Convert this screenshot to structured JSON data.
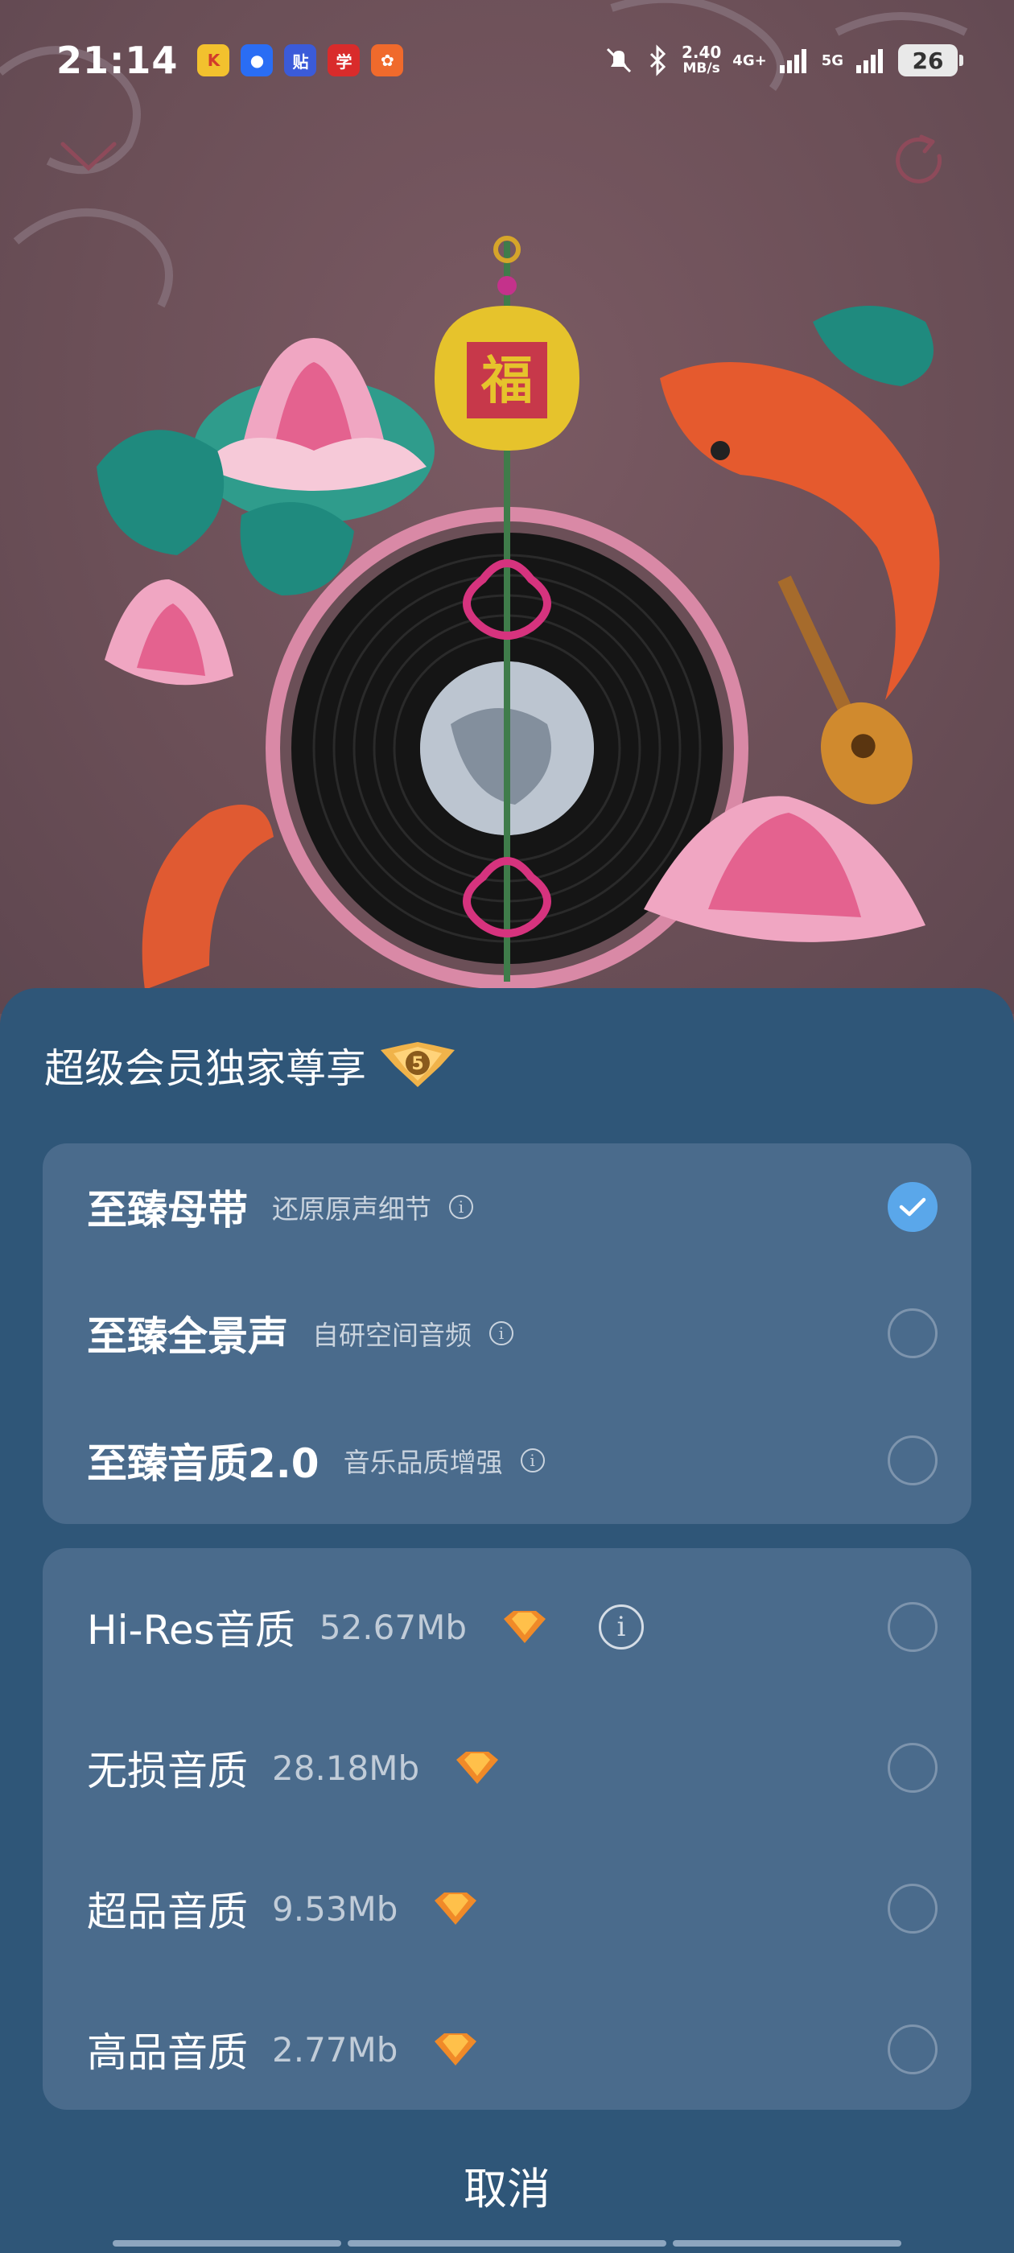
{
  "status_bar": {
    "time": "21:14",
    "notification_apps": [
      "kuaishou-icon",
      "browser-icon",
      "tieba-icon",
      "study-icon",
      "kugou-icon"
    ],
    "speed_value": "2.40",
    "speed_unit": "MB/s",
    "net1": "4G+",
    "net2": "5G",
    "battery": "26"
  },
  "sheet": {
    "title": "超级会员独家尊享",
    "vip_badge": "5",
    "premium_options": [
      {
        "name": "至臻母带",
        "desc": "还原原声细节",
        "selected": true
      },
      {
        "name": "至臻全景声",
        "desc": "自研空间音频",
        "selected": false
      },
      {
        "name": "至臻音质2.0",
        "desc": "音乐品质增强",
        "selected": false
      }
    ],
    "quality_options": [
      {
        "name": "Hi-Res音质",
        "size": "52.67Mb",
        "selected": false
      },
      {
        "name": "无损音质",
        "size": "28.18Mb",
        "selected": false
      },
      {
        "name": "超品音质",
        "size": "9.53Mb",
        "selected": false
      },
      {
        "name": "高品音质",
        "size": "2.77Mb",
        "selected": false
      }
    ],
    "cancel_label": "取消"
  },
  "artwork": {
    "fu_char": "福"
  },
  "colors": {
    "sheet_bg": "#2f5678",
    "card_bg": "#4a6b8c",
    "check_accent": "#5aa7ea",
    "background": "#6c5058"
  }
}
